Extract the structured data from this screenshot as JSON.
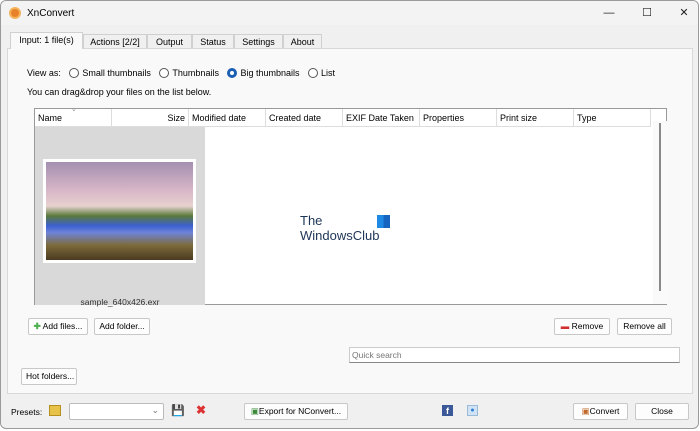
{
  "window": {
    "title": "XnConvert",
    "controls": [
      "minimize",
      "maximize",
      "close"
    ]
  },
  "tabs": [
    {
      "label": "Input: 1 file(s)",
      "active": true
    },
    {
      "label": "Actions [2/2]"
    },
    {
      "label": "Output"
    },
    {
      "label": "Status"
    },
    {
      "label": "Settings"
    },
    {
      "label": "About"
    }
  ],
  "view_as": {
    "label": "View as:",
    "options": [
      "Small thumbnails",
      "Thumbnails",
      "Big thumbnails",
      "List"
    ],
    "selected": "Big thumbnails"
  },
  "hint": "You can drag&drop your files on the list below.",
  "table": {
    "columns": [
      "Name",
      "Size",
      "Modified date",
      "Created date",
      "EXIF Date Taken",
      "Properties",
      "Print size",
      "Type"
    ],
    "files": [
      {
        "caption": "sample_640x426.exr"
      }
    ]
  },
  "watermark": {
    "line1": "The",
    "line2": "WindowsClub"
  },
  "buttons": {
    "add_files": "Add files...",
    "add_folder": "Add folder...",
    "remove": "Remove",
    "remove_all": "Remove all",
    "hot_folders": "Hot folders...",
    "export": "Export for NConvert...",
    "convert": "Convert",
    "close": "Close"
  },
  "search": {
    "placeholder": "Quick search",
    "value": ""
  },
  "presets": {
    "label": "Presets:",
    "value": ""
  }
}
